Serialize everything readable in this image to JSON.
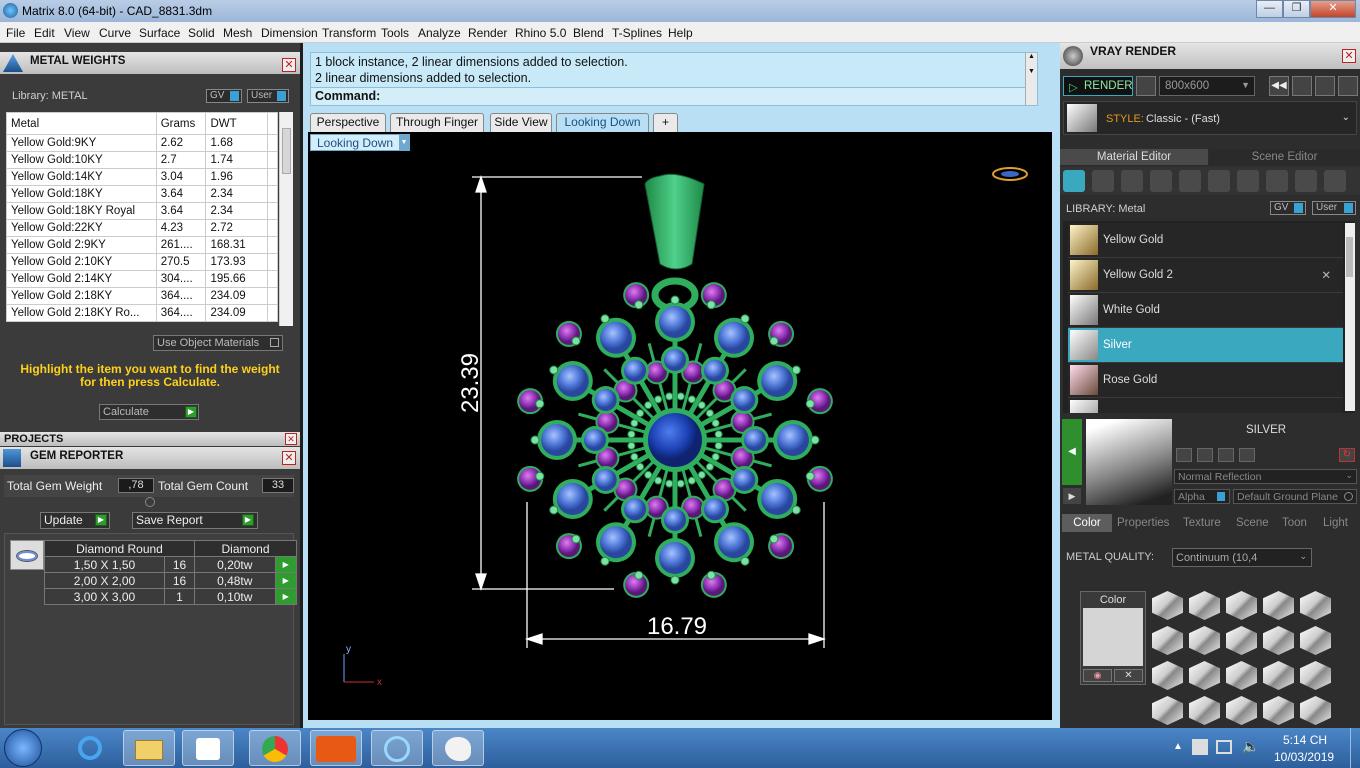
{
  "window": {
    "title": "Matrix 8.0 (64-bit) - CAD_8831.3dm"
  },
  "menu": [
    "File",
    "Edit",
    "View",
    "Curve",
    "Surface",
    "Solid",
    "Mesh",
    "Dimension",
    "Transform",
    "Tools",
    "Analyze",
    "Render",
    "Rhino 5.0",
    "Blend",
    "T-Splines",
    "Help"
  ],
  "metal_weights": {
    "title": "METAL WEIGHTS",
    "library_label": "Library: METAL",
    "gv": "GV",
    "user": "User",
    "columns": [
      "Metal",
      "Grams",
      "DWT"
    ],
    "rows": [
      [
        "Yellow Gold:9KY",
        "2.62",
        "1.68"
      ],
      [
        "Yellow Gold:10KY",
        "2.7",
        "1.74"
      ],
      [
        "Yellow Gold:14KY",
        "3.04",
        "1.96"
      ],
      [
        "Yellow Gold:18KY",
        "3.64",
        "2.34"
      ],
      [
        "Yellow Gold:18KY Royal",
        "3.64",
        "2.34"
      ],
      [
        "Yellow Gold:22KY",
        "4.23",
        "2.72"
      ],
      [
        "Yellow Gold 2:9KY",
        "261....",
        "168.31"
      ],
      [
        "Yellow Gold 2:10KY",
        "270.5",
        "173.93"
      ],
      [
        "Yellow Gold 2:14KY",
        "304....",
        "195.66"
      ],
      [
        "Yellow Gold 2:18KY",
        "364....",
        "234.09"
      ],
      [
        "Yellow Gold 2:18KY Ro...",
        "364....",
        "234.09"
      ]
    ],
    "use_object_materials": "Use Object Materials",
    "hint": "Highlight the item you want to find the weight for then press Calculate.",
    "calculate": "Calculate"
  },
  "projects": {
    "title": "PROJECTS"
  },
  "gem_reporter": {
    "title": "GEM REPORTER",
    "total_weight_label": "Total Gem Weight",
    "total_weight": ",78",
    "total_count_label": "Total Gem Count",
    "total_count": "33",
    "update": "Update",
    "save_report": "Save Report",
    "headers": [
      "Diamond Round",
      "Diamond"
    ],
    "rows": [
      [
        "1,50 X 1,50",
        "16",
        "0,20tw"
      ],
      [
        "2,00 X 2,00",
        "16",
        "0,48tw"
      ],
      [
        "3,00 X 3,00",
        "1",
        "0,10tw"
      ]
    ]
  },
  "command": {
    "line1": "1 block instance, 2 linear dimensions added to selection.",
    "line2": "2 linear dimensions added to selection.",
    "prompt": "Command:"
  },
  "viewport_tabs": [
    "Perspective",
    "Through Finger",
    "Side View",
    "Looking Down"
  ],
  "active_tab": "Looking Down",
  "viewport": {
    "label": "Looking Down",
    "dim_height": "23.39",
    "dim_width": "16.79",
    "axis_y": "y",
    "axis_x": "x"
  },
  "vray": {
    "title": "VRAY RENDER",
    "render": "RENDER",
    "resolution": "800x600",
    "style_label": "STYLE:",
    "style_value": "Classic - (Fast)",
    "tab_material": "Material Editor",
    "tab_scene": "Scene Editor",
    "library_label": "LIBRARY: Metal",
    "gv": "GV",
    "user": "User",
    "materials": [
      "Yellow Gold",
      "Yellow Gold 2",
      "White Gold",
      "Silver",
      "Rose Gold"
    ],
    "selected_material": "Silver",
    "preview_title": "SILVER",
    "reflection": "Normal Reflection",
    "alpha": "Alpha",
    "ground": "Default Ground Plane",
    "bottom_tabs": [
      "Color",
      "Properties",
      "Texture",
      "Scene",
      "Toon",
      "Light"
    ],
    "metal_quality_label": "METAL QUALITY:",
    "metal_quality_value": "Continuum (10,4",
    "color_label": "Color"
  },
  "clock": {
    "time": "5:14 CH",
    "date": "10/03/2019"
  },
  "colors": {
    "accent": "#3aa9bf",
    "hint": "#ffd11a",
    "metal": "#2fae5e",
    "center_stone": "#1a3fb0"
  }
}
